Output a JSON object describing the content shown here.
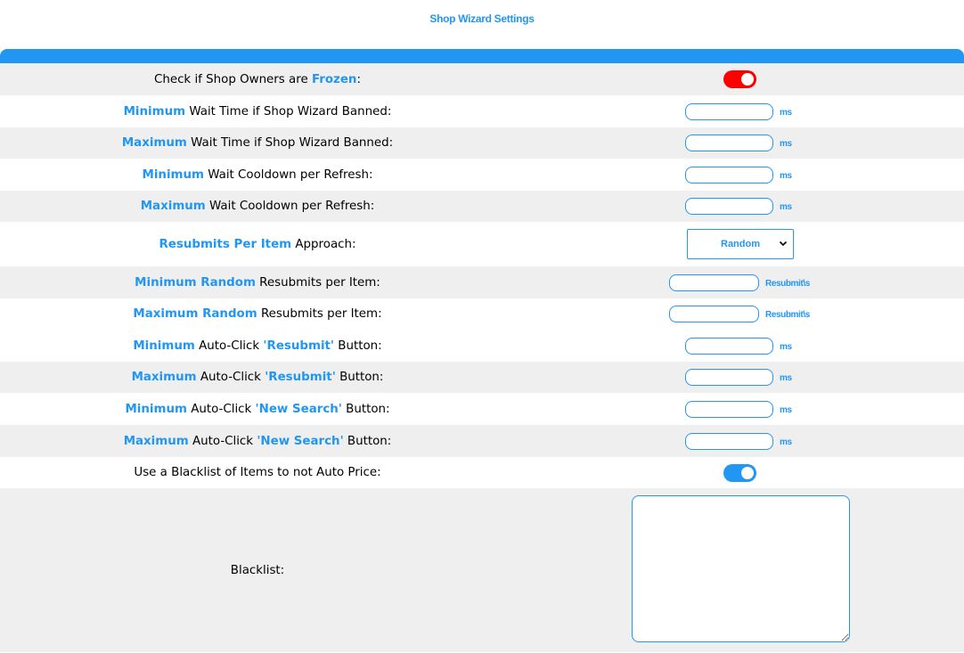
{
  "title": "Shop Wizard Settings",
  "accent_color": "#2196f3",
  "rows": [
    {
      "id": "frozen",
      "pre": "Check if Shop Owners are ",
      "hl": "Frozen",
      "post": ":",
      "control": "toggle",
      "toggle_on": true,
      "toggle_color": "#ff0000"
    },
    {
      "id": "min-wait-banned",
      "hl": "Minimum",
      "post": " Wait Time if Shop Wizard Banned:",
      "control": "text",
      "value": "",
      "unit": "ms"
    },
    {
      "id": "max-wait-banned",
      "hl": "Maximum",
      "post": " Wait Time if Shop Wizard Banned:",
      "control": "text",
      "value": "",
      "unit": "ms"
    },
    {
      "id": "min-cooldown",
      "hl": "Minimum",
      "post": " Wait Cooldown per Refresh:",
      "control": "text",
      "value": "",
      "unit": "ms"
    },
    {
      "id": "max-cooldown",
      "hl": "Maximum",
      "post": " Wait Cooldown per Refresh:",
      "control": "text",
      "value": "",
      "unit": "ms"
    },
    {
      "id": "resubmits-approach",
      "hl": "Resubmits Per Item",
      "post": " Approach:",
      "control": "select",
      "selected": "Random"
    },
    {
      "id": "min-random-resubmits",
      "hl": "Minimum Random",
      "post": " Resubmits per Item:",
      "control": "text",
      "value": "",
      "unit": "Resubmit\\s"
    },
    {
      "id": "max-random-resubmits",
      "hl": "Maximum Random",
      "post": " Resubmits per Item:",
      "control": "text",
      "value": "",
      "unit": "Resubmit\\s"
    },
    {
      "id": "min-autoclick-resubmit",
      "hl": "Minimum",
      "mid": " Auto-Click ",
      "hl2": "'Resubmit'",
      "post": " Button:",
      "control": "text",
      "value": "",
      "unit": "ms"
    },
    {
      "id": "max-autoclick-resubmit",
      "hl": "Maximum",
      "mid": " Auto-Click ",
      "hl2": "'Resubmit'",
      "post": " Button:",
      "control": "text",
      "value": "",
      "unit": "ms"
    },
    {
      "id": "min-autoclick-newsearch",
      "hl": "Minimum",
      "mid": " Auto-Click ",
      "hl2": "'New Search'",
      "post": " Button:",
      "control": "text",
      "value": "",
      "unit": "ms"
    },
    {
      "id": "max-autoclick-newsearch",
      "hl": "Maximum",
      "mid": " Auto-Click ",
      "hl2": "'New Search'",
      "post": " Button:",
      "control": "text",
      "value": "",
      "unit": "ms"
    },
    {
      "id": "use-blacklist",
      "pre": "Use a Blacklist of Items to not Auto Price:",
      "control": "toggle",
      "toggle_on": true,
      "toggle_color": "#2196f3"
    },
    {
      "id": "blacklist",
      "pre": "Blacklist:",
      "control": "textarea",
      "value": ""
    }
  ]
}
